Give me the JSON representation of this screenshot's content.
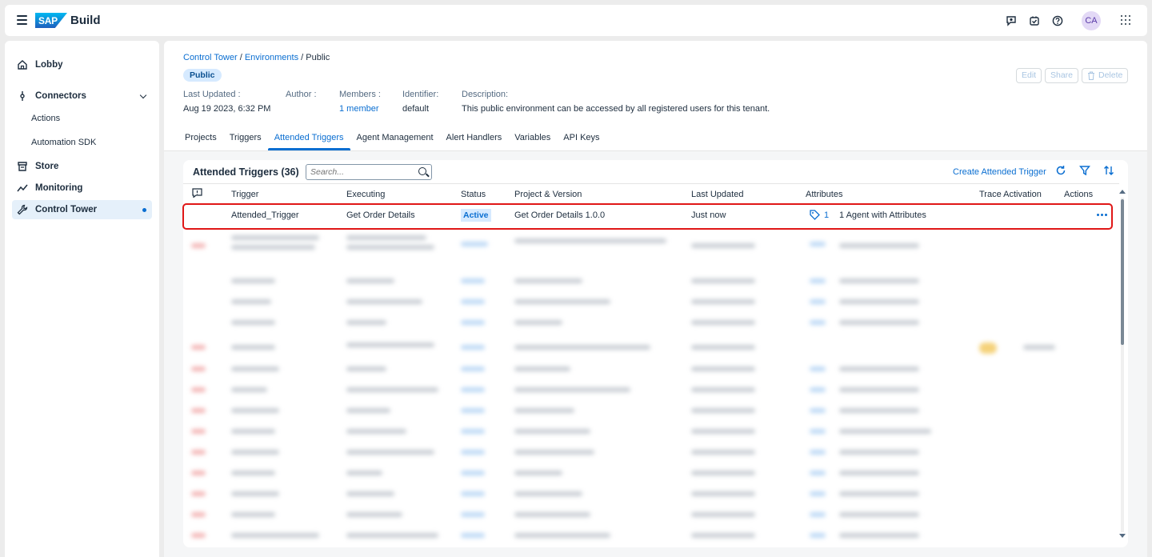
{
  "shell": {
    "logo_text": "SAP",
    "product": "Build",
    "avatar_initials": "CA",
    "icons": [
      "notifications-icon",
      "tasks-icon",
      "help-icon",
      "product-switch-icon"
    ]
  },
  "sidenav": {
    "items": [
      {
        "label": "Lobby",
        "icon": "home-icon"
      },
      {
        "label": "Connectors",
        "icon": "connector-icon"
      },
      {
        "label": "Actions"
      },
      {
        "label": "Automation SDK"
      },
      {
        "label": "Store",
        "icon": "store-icon"
      },
      {
        "label": "Monitoring",
        "icon": "monitoring-icon"
      },
      {
        "label": "Control Tower",
        "icon": "wrench-icon"
      }
    ]
  },
  "header": {
    "breadcrumb": {
      "part1": "Control Tower",
      "sep1": " / ",
      "part2": "Environments",
      "sep2": " / ",
      "current": "Public"
    },
    "badge": "Public",
    "meta": {
      "last_updated_label": "Last Updated :",
      "last_updated_value": "Aug 19 2023, 6:32 PM",
      "author_label": "Author :",
      "members_label": "Members :",
      "members_value": "1 member",
      "identifier_label": "Identifier:",
      "identifier_value": "default",
      "description_label": "Description:",
      "description_value": "This public environment can be accessed by all registered users for this tenant."
    },
    "buttons": {
      "edit": "Edit",
      "share": "Share",
      "delete": "Delete"
    },
    "tabs": [
      "Projects",
      "Triggers",
      "Attended Triggers",
      "Agent Management",
      "Alert Handlers",
      "Variables",
      "API Keys"
    ],
    "active_tab": "Attended Triggers"
  },
  "table": {
    "title": "Attended Triggers (36)",
    "search_placeholder": "Search...",
    "create_link": "Create Attended Trigger",
    "columns": [
      "Trigger",
      "Executing",
      "Status",
      "Project & Version",
      "Last Updated",
      "Attributes",
      "Trace Activation",
      "Actions"
    ],
    "rows": [
      {
        "trigger": "Attended_Trigger",
        "executing": "Get Order Details",
        "status": "Active",
        "project_version": "Get Order Details 1.0.0",
        "last_updated": "Just now",
        "attributes_count": "1",
        "attributes_text": "1 Agent with Attributes"
      }
    ]
  },
  "colors": {
    "accent": "#0a6ed1",
    "highlight_border": "#e01717",
    "badge_bg": "#d6eaff"
  }
}
